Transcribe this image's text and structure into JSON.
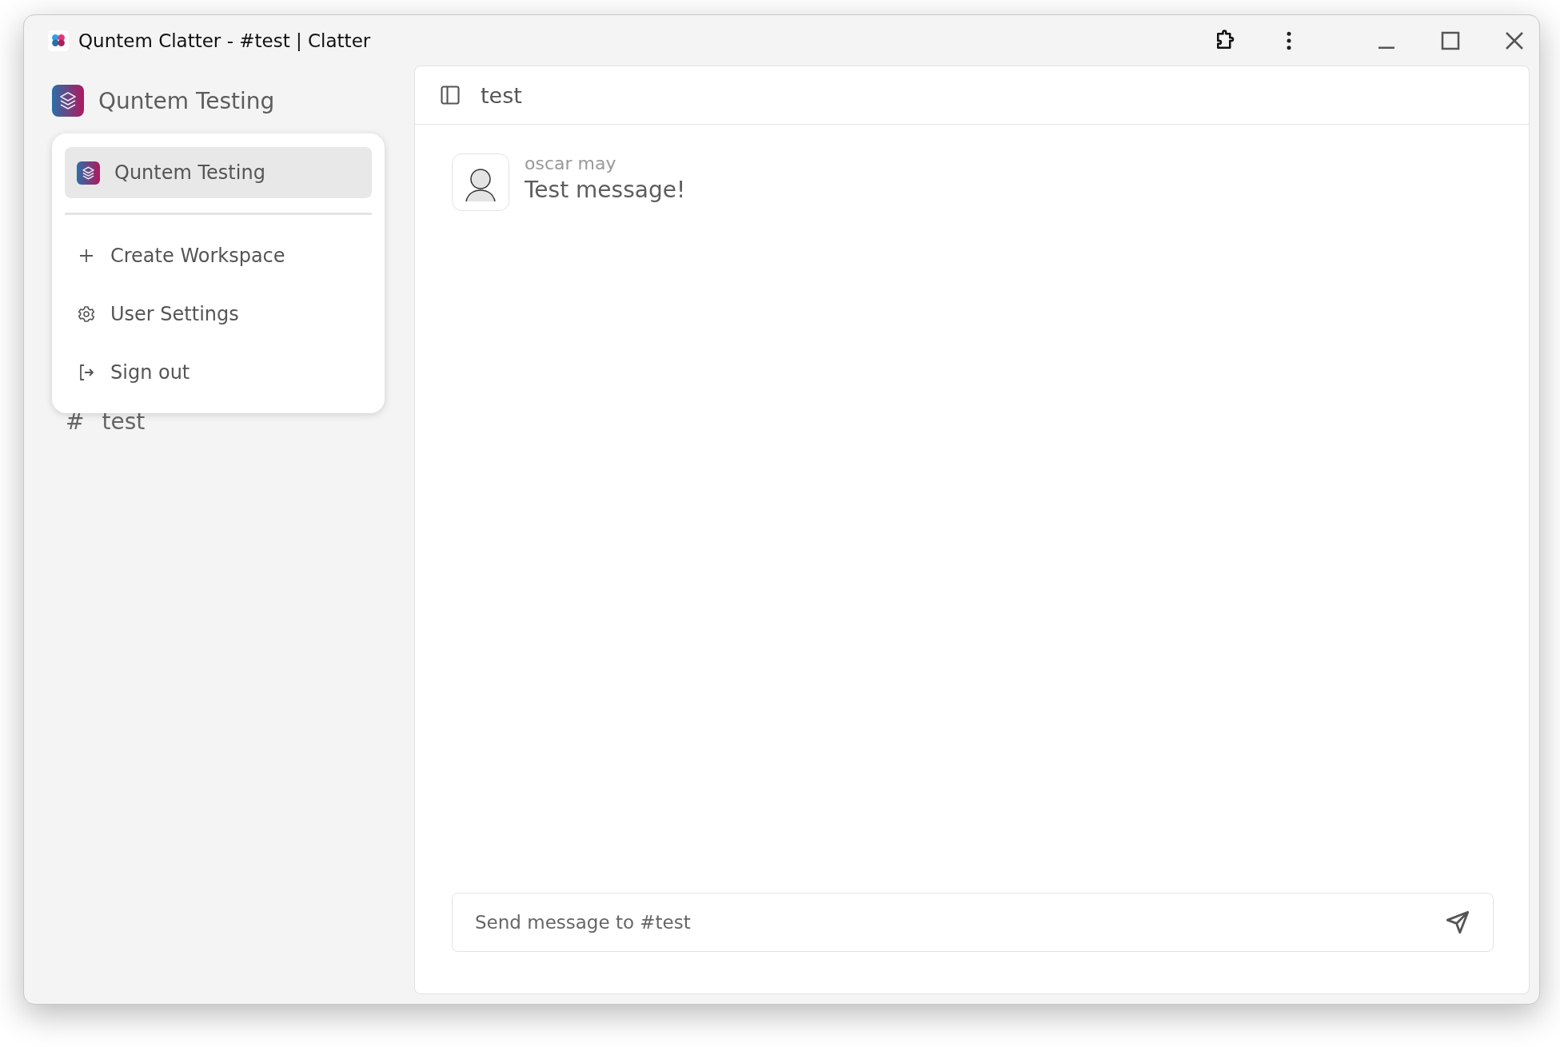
{
  "window": {
    "title": "Quntem Clatter - #test | Clatter"
  },
  "sidebar": {
    "workspace": "Quntem Testing",
    "channels": [
      {
        "name": "test",
        "prefix": "#"
      }
    ]
  },
  "workspace_menu": {
    "open": true,
    "workspaces": [
      {
        "name": "Quntem Testing",
        "selected": true
      }
    ],
    "items": [
      {
        "kind": "create",
        "label": "Create Workspace"
      },
      {
        "kind": "settings",
        "label": "User Settings"
      },
      {
        "kind": "signout",
        "label": "Sign out"
      }
    ]
  },
  "channel_header": {
    "name": "test"
  },
  "messages": [
    {
      "author": "oscar may",
      "text": "Test message!"
    }
  ],
  "composer": {
    "placeholder": "Send message to #test"
  }
}
